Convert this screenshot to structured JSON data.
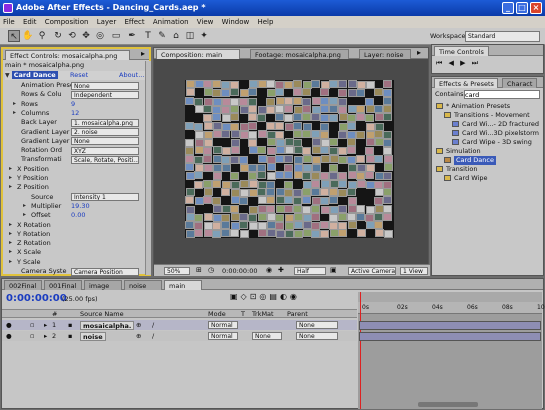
{
  "window": {
    "title": "Adobe After Effects - Dancing_Cards.aep *",
    "min": "_",
    "max": "□",
    "close": "×"
  },
  "menu": [
    "File",
    "Edit",
    "Composition",
    "Layer",
    "Effect",
    "Animation",
    "View",
    "Window",
    "Help"
  ],
  "toolbar": {
    "workspace_label": "Workspace:",
    "workspace_value": "Standard"
  },
  "effect_controls": {
    "tab_label": "Effect Controls: mosaicalpha.png",
    "title": "main * mosaicalpha.png",
    "effect_name": "Card Dance",
    "reset": "Reset",
    "about": "About...",
    "rows": [
      {
        "label": "Animation Preset",
        "type": "dropdown",
        "value": "None"
      },
      {
        "label": "Rows & Colu",
        "type": "dropdown",
        "value": "Independent"
      },
      {
        "label": "Rows",
        "type": "value",
        "value": "9"
      },
      {
        "label": "Columns",
        "type": "value",
        "value": "12"
      },
      {
        "label": "Back Layer",
        "type": "dropdown",
        "value": "1. mosaicalpha.png"
      },
      {
        "label": "Gradient Layer 1",
        "type": "dropdown",
        "value": "2. noise"
      },
      {
        "label": "Gradient Layer 2",
        "type": "dropdown",
        "value": "None"
      },
      {
        "label": "Rotation Ord",
        "type": "dropdown",
        "value": "XYZ"
      },
      {
        "label": "Transformati",
        "type": "dropdown",
        "value": "Scale, Rotate, Positi..."
      },
      {
        "label": "X Position",
        "type": "group"
      },
      {
        "label": "Y Position",
        "type": "group"
      },
      {
        "label": "Z Position",
        "type": "group"
      },
      {
        "label": "Source",
        "type": "dropdown",
        "value": "Intensity 1"
      },
      {
        "label": "Multiplier",
        "type": "value",
        "value": "19.30"
      },
      {
        "label": "Offset",
        "type": "value",
        "value": "0.00"
      },
      {
        "label": "X Rotation",
        "type": "group"
      },
      {
        "label": "Y Rotation",
        "type": "group"
      },
      {
        "label": "Z Rotation",
        "type": "group"
      },
      {
        "label": "X Scale",
        "type": "group"
      },
      {
        "label": "Y Scale",
        "type": "group"
      },
      {
        "label": "Camera Syste",
        "type": "dropdown",
        "value": "Camera Position"
      }
    ]
  },
  "composition": {
    "tab_comp": "Composition: main",
    "tab_footage": "Footage: mosaicalpha.png",
    "tab_layer": "Layer: noise",
    "zoom": "50%",
    "timecode": "0:00:00:00",
    "resolution": "Half",
    "camera": "Active Camera",
    "view": "1 View"
  },
  "time_controls": {
    "tab": "Time Controls"
  },
  "effects_presets": {
    "tab": "Effects & Presets",
    "tab2": "Charact",
    "contains_label": "Contains:",
    "search_value": "card",
    "tree": [
      {
        "label": "* Animation Presets",
        "level": 0
      },
      {
        "label": "Transitions - Movement",
        "level": 1
      },
      {
        "label": "Card Wi...- 2D fractured",
        "level": 2
      },
      {
        "label": "Card Wi...3D pixelstorm",
        "level": 2
      },
      {
        "label": "Card Wipe - 3D swing",
        "level": 2
      },
      {
        "label": "Simulation",
        "level": 0
      },
      {
        "label": "Card Dance",
        "level": 1,
        "selected": true
      },
      {
        "label": "Transition",
        "level": 0
      },
      {
        "label": "Card Wipe",
        "level": 1
      }
    ]
  },
  "timeline": {
    "tabs": [
      "002Final",
      "001Final",
      "image",
      "noise",
      "main"
    ],
    "timecode": "0:00:00:00",
    "fps": "(25.00 fps)",
    "headers": {
      "num": "#",
      "source": "Source Name",
      "mode": "Mode",
      "t": "T",
      "trkmat": "TrkMat",
      "parent": "Parent"
    },
    "ruler": [
      "0s",
      "02s",
      "04s",
      "06s",
      "08s",
      "10s"
    ],
    "layers": [
      {
        "num": "1",
        "name": "mosaicalpha.",
        "mode": "Normal",
        "trkmat": "",
        "parent": "None"
      },
      {
        "num": "2",
        "name": "noise",
        "mode": "Normal",
        "trkmat": "None",
        "parent": "None"
      }
    ]
  }
}
